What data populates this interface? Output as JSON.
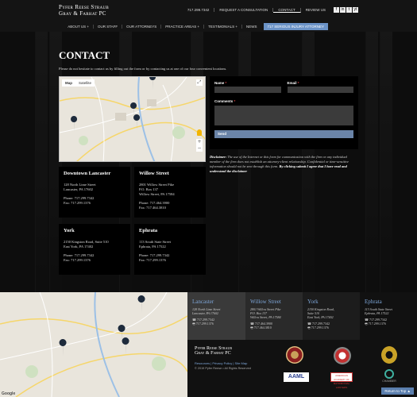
{
  "header": {
    "logo_line1": "Pyfer Reese Straub",
    "logo_line2": "Gray & Farhat PC",
    "phone": "717.299.7342",
    "request": "Request a Consultation",
    "contact": "Contact",
    "review": "Review Us",
    "social": [
      "f",
      "in",
      "t",
      "yt"
    ]
  },
  "nav": {
    "items": [
      "About Us +",
      "Our Staff",
      "Our Attorneys",
      "Practice Areas +",
      "Testimonials +",
      "News"
    ],
    "cta": "717 Serious Injury Attorney"
  },
  "page": {
    "title": "CONTACT",
    "intro": "Please do not hesitate to contact us by filling out the form or by contacting us at one of our four convenient locations."
  },
  "map": {
    "tab_map": "Map",
    "tab_sat": "Satellite",
    "fullscreen": "⤢",
    "zoom_in": "+",
    "zoom_out": "−"
  },
  "offices": [
    {
      "name": "Downtown Lancaster",
      "addr1": "128 North Lime Street",
      "addr2": "Lancaster, PA 17602",
      "phone": "Phone: 717.299.7342",
      "fax": "Fax: 717.299.1376"
    },
    {
      "name": "Willow Street",
      "addr1": "2801 Willow Street Pike",
      "addr2": "P.O. Box 137",
      "addr3": "Willow Street, PA 17584",
      "phone": "Phone: 717.464.3900",
      "fax": "Fax: 717.464.3810"
    },
    {
      "name": "York",
      "addr1": "2150 Kingston Road, Suite 510",
      "addr2": "East York, PA 17402",
      "phone": "Phone: 717.299.7342",
      "fax": "Fax: 717.299.1376"
    },
    {
      "name": "Ephrata",
      "addr1": "113 South State Street",
      "addr2": "Ephrata, PA 17522",
      "phone": "Phone: 717.299.7342",
      "fax": "Fax: 717.299.1376"
    }
  ],
  "form": {
    "name_label": "Name",
    "email_label": "Email",
    "comments_label": "Comments",
    "required_mark": "*",
    "send_label": "Send"
  },
  "disclaimer": {
    "lead": "Disclaimer:",
    "body": " The use of the Internet or this form for communication with the firm or any individual member of the firm does not establish an attorney-client relationship. Confidential or time-sensitive information should not be sent through this form. ",
    "agree": "By clicking submit I agree that I have read and understand the disclaimer"
  },
  "footer": {
    "offices": [
      {
        "name": "Lancaster",
        "l1": "128 North Lime Street",
        "l2": "Lancaster, PA 17602",
        "p": "717.299.7342",
        "f": "717.299.1376"
      },
      {
        "name": "Willow Street",
        "l1": "2801 Willow Street Pike",
        "l2": "P.O. Box 137",
        "l3": "Willow Street, PA 17584",
        "p": "717.464.3900",
        "f": "717.464.3810"
      },
      {
        "name": "York",
        "l1": "2150 Kingston Road,",
        "l2": "Suite 510",
        "l3": "East York, PA 17402",
        "p": "717.299.7342",
        "f": "717.299.1376"
      },
      {
        "name": "Ephrata",
        "l1": "113 South State Street",
        "l2": "Ephrata, PA 17522",
        "p": "717.299.7342",
        "f": "717.299.1376"
      }
    ],
    "logo_line1": "Pyfer Reese Straub",
    "logo_line2": "Gray & Farhat PC",
    "links": "Resources  |  Privacy Policy  |  Site Map",
    "copyright": "© 2019 Pyfer Reese  •  All Rights Reserved",
    "aaml": "AAML",
    "badge_text": "AMERICAN ACADEMY OF MATRIMONIAL LAWYERS",
    "chamber": "CHAMBER",
    "google": "Google",
    "to_top": "Return to Top ▲"
  }
}
